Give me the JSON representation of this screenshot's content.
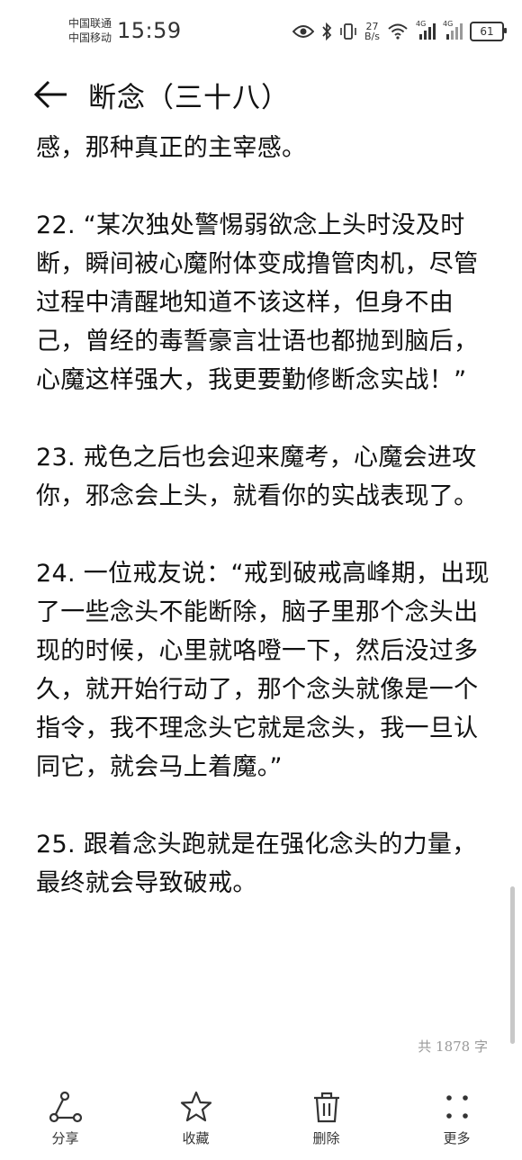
{
  "status_bar": {
    "carrier1": "中国联通",
    "carrier2": "中国移动",
    "time": "15:59",
    "net_speed_value": "27",
    "net_speed_unit": "B/s",
    "signal1_label": "4G",
    "signal2_label": "4G",
    "battery": "61",
    "icons": [
      "eye-icon",
      "bluetooth-icon",
      "vibrate-icon",
      "wifi-icon",
      "signal-icon",
      "battery-icon"
    ]
  },
  "header": {
    "title": "断念（三十八）",
    "back_icon": "back-arrow-icon"
  },
  "content": {
    "paragraphs": [
      "感，那种真正的主宰感。",
      "22. “某次独处警惕弱欲念上头时没及时断，瞬间被心魔附体变成撸管肉机，尽管过程中清醒地知道不该这样，但身不由己，曾经的毒誓豪言壮语也都抛到脑后，心魔这样强大，我更要勤修断念实战！”",
      "23. 戒色之后也会迎来魔考，心魔会进攻你，邪念会上头，就看你的实战表现了。",
      "24. 一位戒友说：“戒到破戒高峰期，出现了一些念头不能断除，脑子里那个念头出现的时候，心里就咯噔一下，然后没过多久，就开始行动了，那个念头就像是一个指令，我不理念头它就是念头，我一旦认同它，就会马上着魔。”",
      "25. 跟着念头跑就是在强化念头的力量，最终就会导致破戒。"
    ],
    "word_count": "共 1878 字"
  },
  "toolbar": {
    "items": [
      {
        "label": "分享",
        "icon": "share-icon"
      },
      {
        "label": "收藏",
        "icon": "star-icon"
      },
      {
        "label": "删除",
        "icon": "trash-icon"
      },
      {
        "label": "更多",
        "icon": "more-icon"
      }
    ]
  },
  "colors": {
    "text": "#111111",
    "muted": "#9a9a9a",
    "background": "#ffffff"
  }
}
